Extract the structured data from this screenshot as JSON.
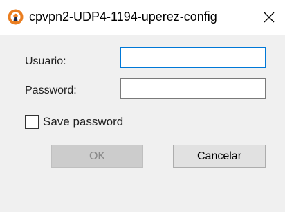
{
  "window": {
    "title": "cpvpn2-UDP4-1194-uperez-config",
    "icon": "openvpn-icon",
    "close_glyph": "✕"
  },
  "form": {
    "username_label": "Usuario:",
    "username_value": "",
    "password_label": "Password:",
    "password_value": "",
    "save_password_label": "Save password",
    "save_password_checked": false
  },
  "buttons": {
    "ok_label": "OK",
    "ok_enabled": false,
    "cancel_label": "Cancelar"
  },
  "colors": {
    "accent": "#0078d7",
    "openvpn_orange": "#ea7e20"
  }
}
